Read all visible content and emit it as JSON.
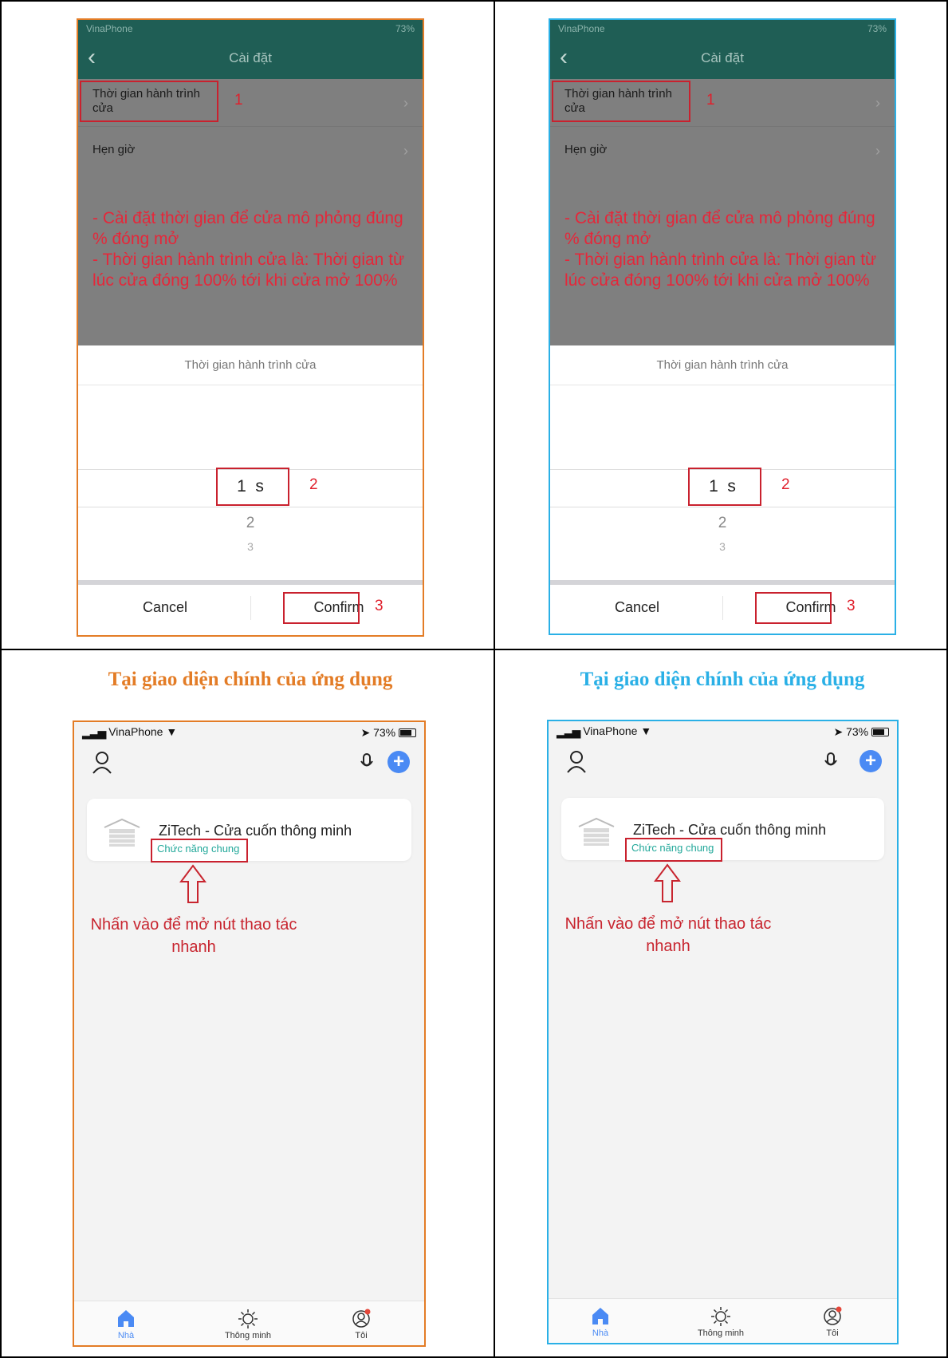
{
  "colors": {
    "orange": "#e37c26",
    "blue": "#2ab0e6",
    "annotation_red": "#c9212e",
    "header_green": "#1f5e55",
    "accent_blue": "#4a8af4",
    "teal_text": "#22a89a"
  },
  "settings_screen": {
    "status": {
      "carrier": "VinaPhone",
      "battery": "73%"
    },
    "nav": {
      "back_icon": "chevron-left-icon",
      "title": "Cài đặt"
    },
    "rows": [
      {
        "label": "Thời gian hành trình cửa",
        "marker": "1"
      },
      {
        "label": "Hẹn giờ"
      }
    ],
    "note": "- Cài đặt thời gian để cửa mô phỏng đúng % đóng mở\n- Thời gian hành trình cửa là: Thời gian từ lúc cửa đóng 100% tới khi cửa mở 100%",
    "sheet": {
      "title": "Thời gian hành trình cửa",
      "picker": {
        "selected": "1",
        "unit": "s",
        "below": [
          "2",
          "3"
        ],
        "marker": "2"
      },
      "cancel_label": "Cancel",
      "confirm_label": "Confirm",
      "confirm_marker": "3"
    }
  },
  "caption": "Tại giao diện chính của ứng dụng",
  "home_screen": {
    "status": {
      "carrier": "VinaPhone",
      "battery": "73%"
    },
    "device": {
      "name": "ZiTech - Cửa cuốn thông minh",
      "function_label": "Chức năng chung"
    },
    "hint": "Nhấn vào để mở nút thao tác nhanh",
    "tabs": [
      {
        "label": "Nhà",
        "icon": "home-icon",
        "active": true
      },
      {
        "label": "Thông minh",
        "icon": "sun-icon",
        "active": false
      },
      {
        "label": "Tôi",
        "icon": "profile-icon",
        "active": false
      }
    ]
  }
}
